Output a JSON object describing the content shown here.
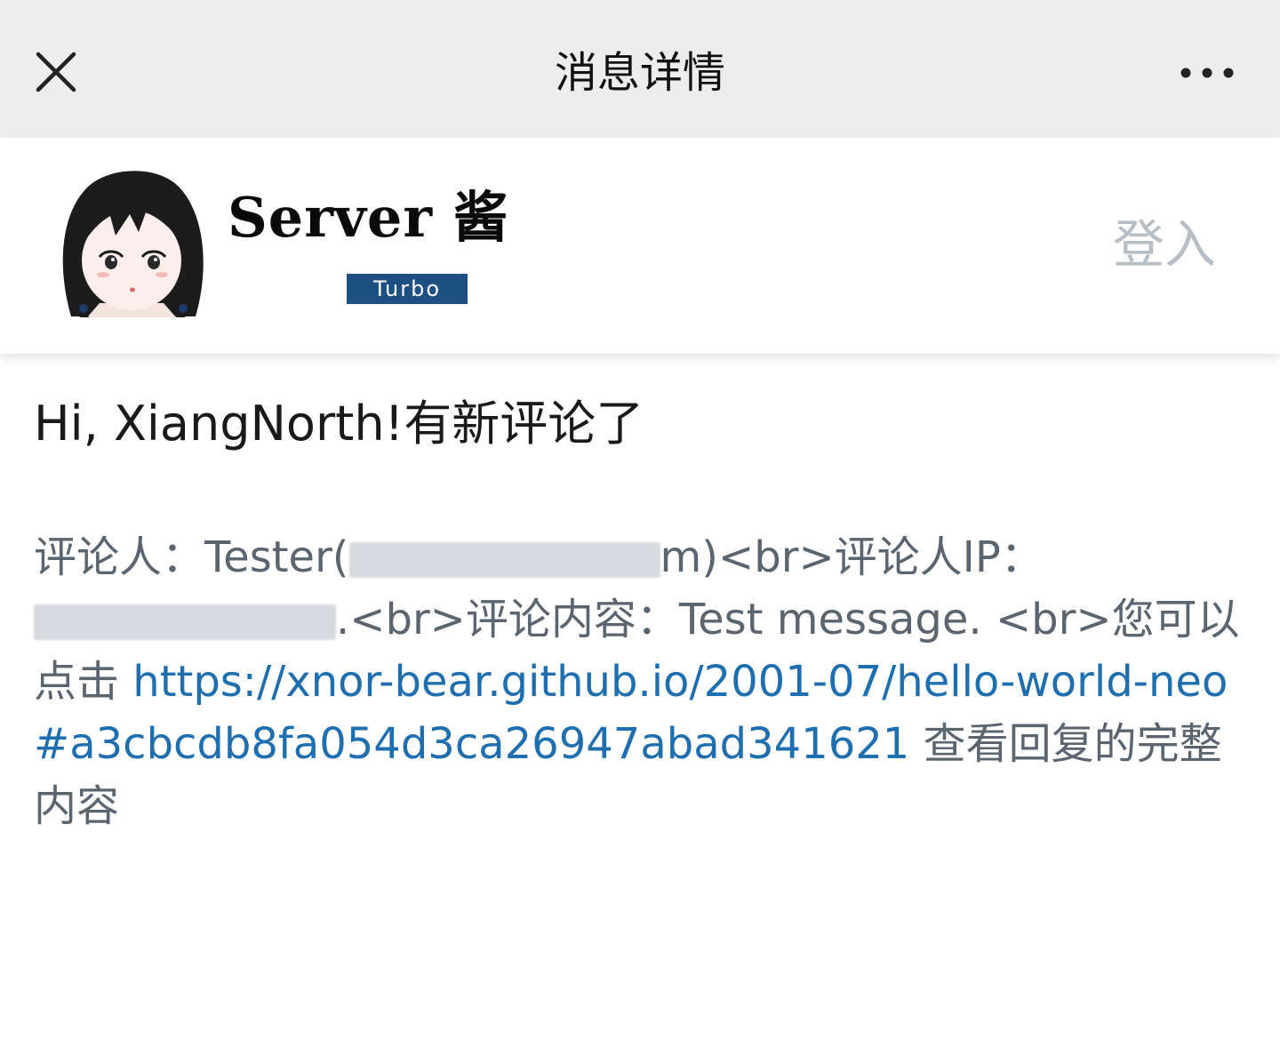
{
  "nav": {
    "title": "消息详情",
    "close_icon": "close-icon",
    "more_icon": "more-dots-icon"
  },
  "header": {
    "brand_name": "Server 酱",
    "badge": "Turbo",
    "login": "登入",
    "badge_color": "#1e4f82"
  },
  "content": {
    "greeting": "Hi, XiangNorth!有新评论了",
    "commenter_label": "评论人：",
    "commenter_name": "Tester(",
    "commenter_email_end": "m)",
    "br1": "<br>",
    "ip_label": "评论人IP：",
    "br2": ".<br>",
    "content_label": "评论内容：",
    "content_text": "Test message. ",
    "br3": "<br>",
    "click_prefix": "您可以点击 ",
    "link": "https://xnor-bear.github.io/2001-07/hello-world-neo#a3cbcdb8fa054d3ca26947abad341621",
    "click_suffix": " 查看回复的完整内容",
    "link_color": "#1f6fb0"
  }
}
